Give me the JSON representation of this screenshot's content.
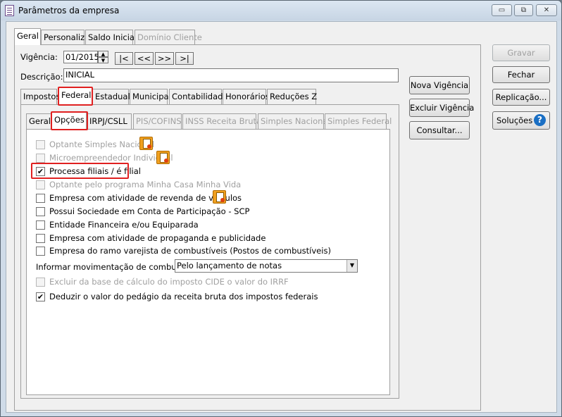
{
  "window": {
    "title": "Parâmetros da empresa",
    "minimize": "▭",
    "restore": "⧉",
    "close": "✕"
  },
  "top_tabs": [
    "Geral",
    "Personaliza",
    "Saldo Inicial",
    "Domínio Cliente"
  ],
  "vigencia": {
    "label": "Vigência:",
    "value": "01/2015",
    "nav": [
      "|<",
      "<<",
      ">>",
      ">|"
    ]
  },
  "descricao": {
    "label": "Descrição:",
    "value": "INICIAL"
  },
  "mid_buttons": [
    "Nova Vigência",
    "Excluir Vigência",
    "Consultar..."
  ],
  "right_buttons": {
    "gravar": "Gravar",
    "fechar": "Fechar",
    "replicacao": "Replicação...",
    "solucoes": "Soluções",
    "help": "?"
  },
  "level2_tabs": [
    "Impostos",
    "Federal",
    "Estadual",
    "Municipal",
    "Contabilidade",
    "Honorários",
    "Reduções Z"
  ],
  "level3_tabs": [
    "Geral",
    "Opções",
    "IRPJ/CSLL",
    "PIS/COFINS",
    "INSS Receita Bruta",
    "Simples Nacional",
    "Simples Federal"
  ],
  "options": [
    {
      "label": "Optante Simples Nacional",
      "checked": false,
      "disabled": true
    },
    {
      "label": "Microempreendedor Individual",
      "checked": false,
      "disabled": true
    },
    {
      "label": "Processa filiais / é filial",
      "checked": true,
      "disabled": false
    },
    {
      "label": "Optante pelo programa Minha Casa Minha Vida",
      "checked": false,
      "disabled": true
    },
    {
      "label": "Empresa com atividade de revenda de veículos",
      "checked": false,
      "disabled": false
    },
    {
      "label": "Possui Sociedade em Conta de Participação - SCP",
      "checked": false,
      "disabled": false
    },
    {
      "label": "Entidade Financeira e/ou Equiparada",
      "checked": false,
      "disabled": false
    },
    {
      "label": "Empresa com atividade de propaganda e publicidade",
      "checked": false,
      "disabled": false
    },
    {
      "label": "Empresa do ramo varejista de combustíveis (Postos de combustíveis)",
      "checked": false,
      "disabled": false
    }
  ],
  "combustiveis": {
    "label": "Informar movimentação de combustíveis:",
    "value": "Pelo lançamento de notas"
  },
  "extra_options": [
    {
      "label": "Excluir da base de cálculo do imposto CIDE o valor do IRRF",
      "checked": false,
      "disabled": true
    },
    {
      "label": "Deduzir o valor do pedágio da receita bruta dos impostos federais",
      "checked": true,
      "disabled": false
    }
  ],
  "check_mark": "✔",
  "dropdown_arrow": "▼",
  "spin_up": "▲",
  "spin_down": "▼"
}
